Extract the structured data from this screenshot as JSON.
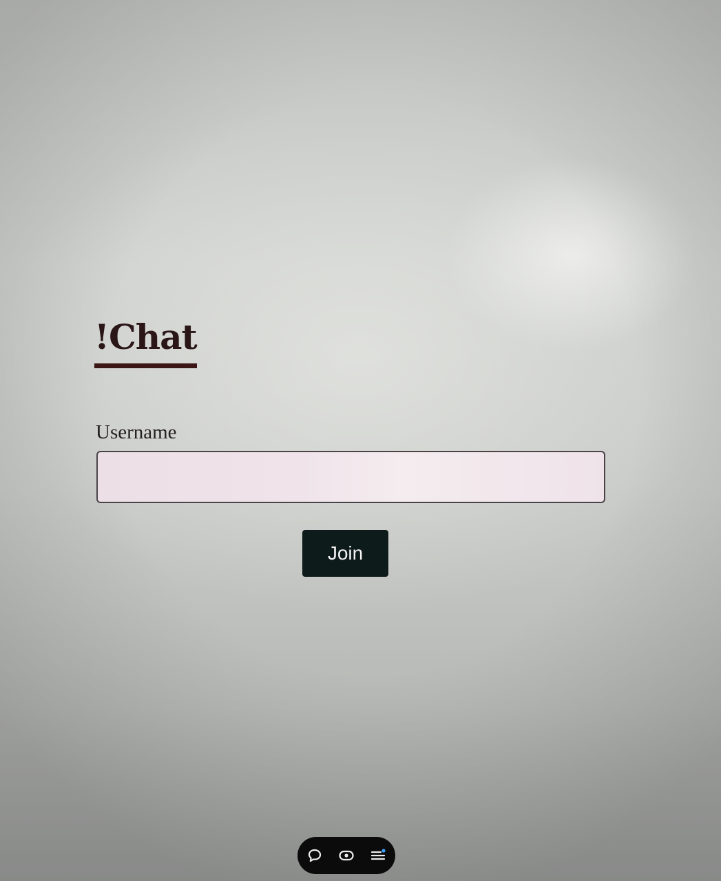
{
  "app": {
    "logo_text": "!Chat",
    "accent_color": "#3c1515"
  },
  "login_form": {
    "username_label": "Username",
    "username_value": "",
    "username_placeholder": "",
    "join_label": "Join"
  },
  "toolbar": {
    "items": [
      {
        "icon": "chat-bubble-icon"
      },
      {
        "icon": "eye-icon"
      },
      {
        "icon": "menu-lines-icon",
        "indicator_color": "#3aa0ff"
      }
    ]
  }
}
